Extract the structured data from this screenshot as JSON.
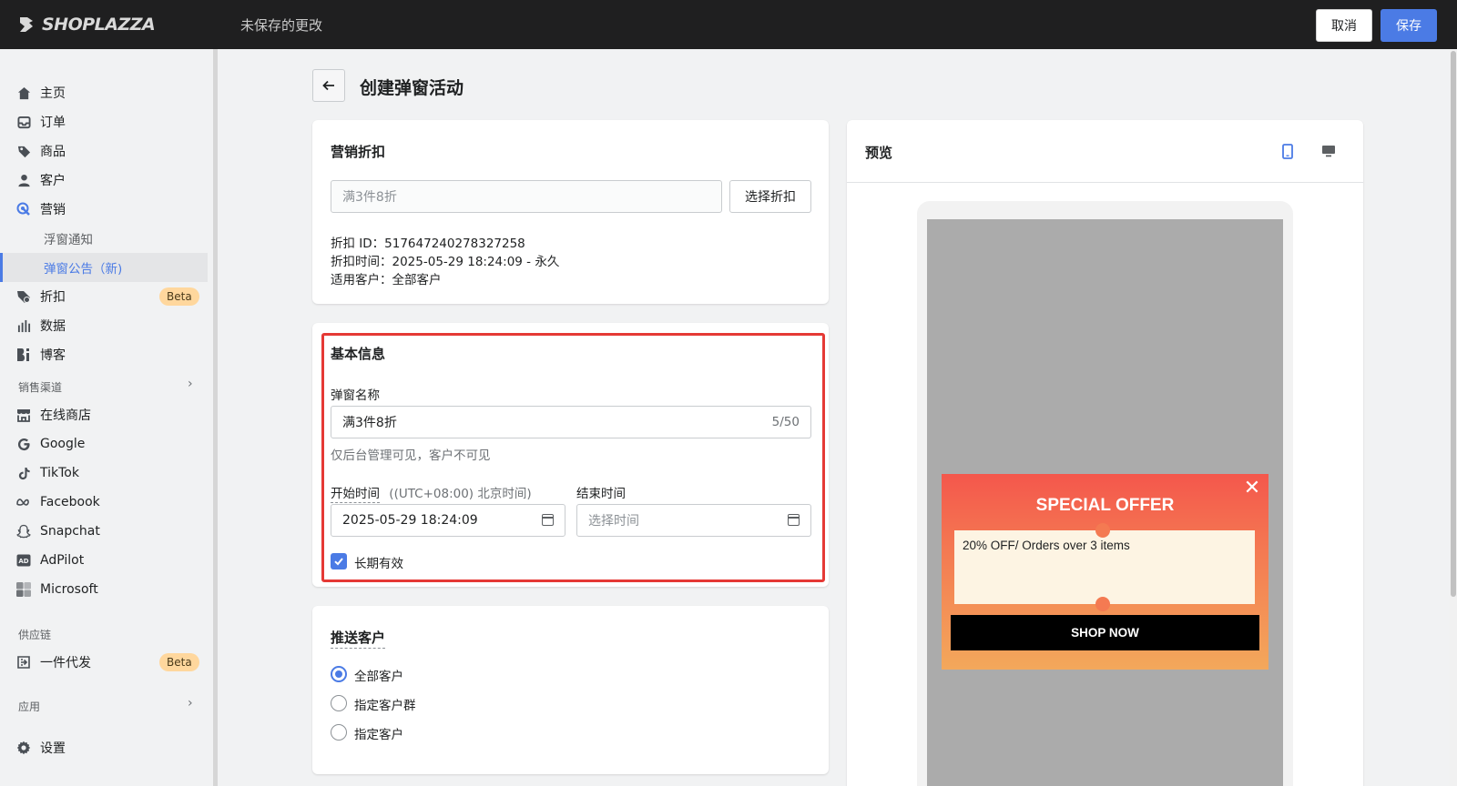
{
  "topbar": {
    "logo_text": "SHOPLAZZA",
    "unsaved_text": "未保存的更改",
    "cancel_label": "取消",
    "save_label": "保存",
    "save_color": "#4b7be5"
  },
  "sidebar": {
    "items": [
      {
        "label": "主页",
        "icon": "home-icon"
      },
      {
        "label": "订单",
        "icon": "inbox-icon"
      },
      {
        "label": "商品",
        "icon": "tag-icon"
      },
      {
        "label": "客户",
        "icon": "person-icon"
      },
      {
        "label": "营销",
        "icon": "target-icon"
      },
      {
        "label": "浮窗通知"
      },
      {
        "label": "弹窗公告（新)"
      },
      {
        "label": "折扣",
        "icon": "discount-icon",
        "badge": "Beta"
      },
      {
        "label": "数据",
        "icon": "bar-chart-icon"
      },
      {
        "label": "博客",
        "icon": "blog-icon"
      }
    ],
    "sales_channels_title": "销售渠道",
    "channels": [
      {
        "label": "在线商店",
        "icon": "store-icon"
      },
      {
        "label": "Google",
        "icon": "google-icon"
      },
      {
        "label": "TikTok",
        "icon": "tiktok-icon"
      },
      {
        "label": "Facebook",
        "icon": "meta-icon"
      },
      {
        "label": "Snapchat",
        "icon": "snapchat-icon"
      },
      {
        "label": "AdPilot",
        "icon": "adpilot-icon"
      },
      {
        "label": "Microsoft",
        "icon": "microsoft-icon"
      }
    ],
    "supply_title": "供应链",
    "supply_items": [
      {
        "label": "一件代发",
        "icon": "dropship-icon",
        "badge": "Beta"
      }
    ],
    "apps_title": "应用",
    "settings_label": "设置"
  },
  "page": {
    "title": "创建弹窗活动"
  },
  "discount_card": {
    "title": "营销折扣",
    "input_placeholder": "满3件8折",
    "select_button": "选择折扣",
    "id_line": "折扣 ID：517647240278327258",
    "time_line": "折扣时间：2025-05-29 18:24:09 - 永久",
    "customer_line": "适用客户：全部客户"
  },
  "basic_card": {
    "title": "基本信息",
    "name_label": "弹窗名称",
    "name_value": "满3件8折",
    "name_counter": "5/50",
    "name_help": "仅后台管理可见，客户不可见",
    "start_label": "开始时间",
    "timezone": "((UTC+08:00) 北京时间)",
    "start_value": "2025-05-29 18:24:09",
    "end_label": "结束时间",
    "end_placeholder": "选择时间",
    "long_term_label": "长期有效",
    "long_term_checked": true
  },
  "push_card": {
    "title": "推送客户",
    "options": [
      "全部客户",
      "指定客户群",
      "指定客户"
    ],
    "selected": "全部客户"
  },
  "preview": {
    "title": "预览",
    "popup_title": "SPECIAL OFFER",
    "coupon_text": "20% OFF/ Orders over 3 items",
    "cta_label": "SHOP NOW",
    "popup_gradient_top": "#f4574c",
    "popup_gradient_bottom": "#f3a85b"
  }
}
